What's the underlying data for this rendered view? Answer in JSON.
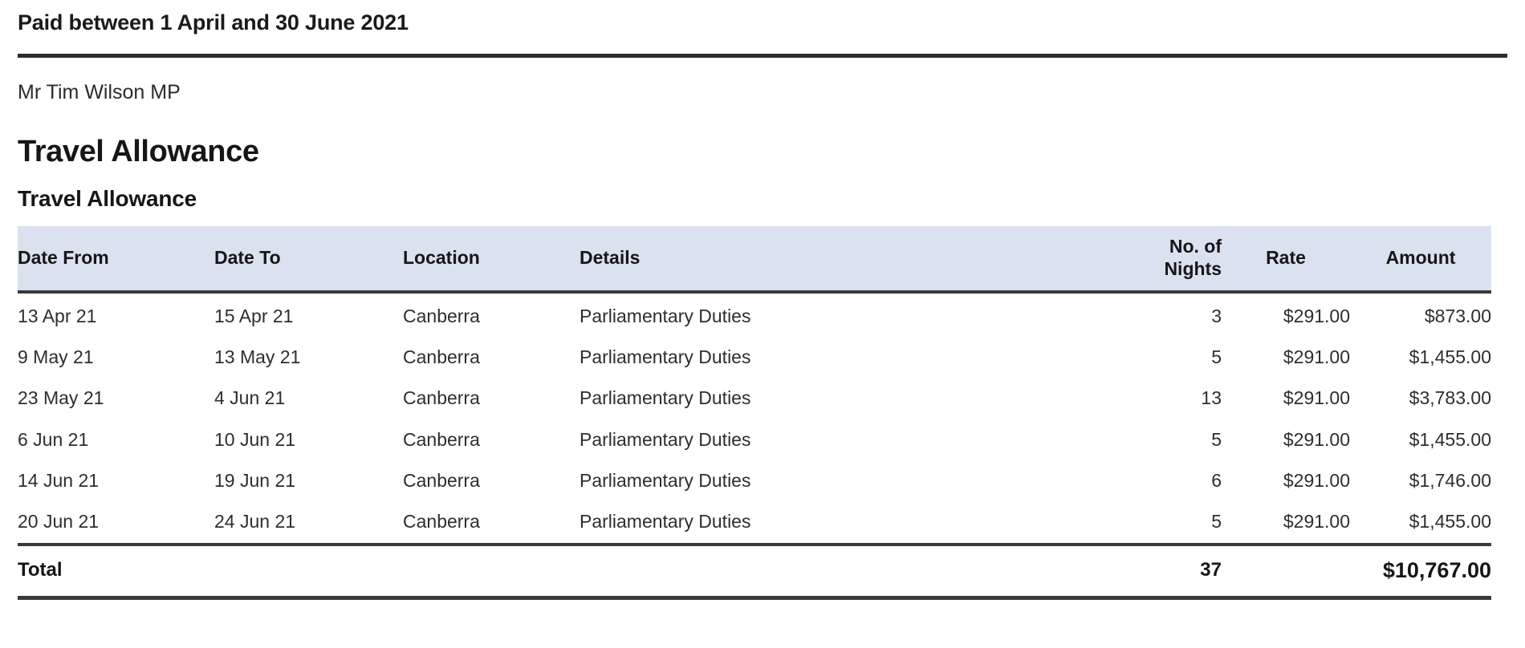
{
  "document": {
    "period_title": "Paid between 1 April and 30 June 2021",
    "member_name": "Mr Tim Wilson MP",
    "section_title": "Travel Allowance",
    "subsection_title": "Travel Allowance"
  },
  "colors": {
    "table_header_background": "#dae2ef",
    "rule": "#2b2b2b",
    "text": "#231f20"
  },
  "table": {
    "columns": [
      {
        "key": "date_from",
        "label": "Date From",
        "align": "left"
      },
      {
        "key": "date_to",
        "label": "Date To",
        "align": "left"
      },
      {
        "key": "location",
        "label": "Location",
        "align": "left"
      },
      {
        "key": "details",
        "label": "Details",
        "align": "left"
      },
      {
        "key": "nights",
        "label": "No. of Nights",
        "align": "right"
      },
      {
        "key": "rate",
        "label": "Rate",
        "align": "right"
      },
      {
        "key": "amount",
        "label": "Amount",
        "align": "right"
      }
    ],
    "header": {
      "date_from": "Date From",
      "date_to": "Date To",
      "location": "Location",
      "details": "Details",
      "nights_line1": "No. of",
      "nights_line2": "Nights",
      "rate": "Rate",
      "amount": "Amount"
    },
    "rows": [
      {
        "date_from": "13 Apr 21",
        "date_to": "15 Apr 21",
        "location": "Canberra",
        "details": "Parliamentary Duties",
        "nights": "3",
        "rate": "$291.00",
        "amount": "$873.00"
      },
      {
        "date_from": "9 May 21",
        "date_to": "13 May 21",
        "location": "Canberra",
        "details": "Parliamentary Duties",
        "nights": "5",
        "rate": "$291.00",
        "amount": "$1,455.00"
      },
      {
        "date_from": "23 May 21",
        "date_to": "4 Jun 21",
        "location": "Canberra",
        "details": "Parliamentary Duties",
        "nights": "13",
        "rate": "$291.00",
        "amount": "$3,783.00"
      },
      {
        "date_from": "6 Jun 21",
        "date_to": "10 Jun 21",
        "location": "Canberra",
        "details": "Parliamentary Duties",
        "nights": "5",
        "rate": "$291.00",
        "amount": "$1,455.00"
      },
      {
        "date_from": "14 Jun 21",
        "date_to": "19 Jun 21",
        "location": "Canberra",
        "details": "Parliamentary Duties",
        "nights": "6",
        "rate": "$291.00",
        "amount": "$1,746.00"
      },
      {
        "date_from": "20 Jun 21",
        "date_to": "24 Jun 21",
        "location": "Canberra",
        "details": "Parliamentary Duties",
        "nights": "5",
        "rate": "$291.00",
        "amount": "$1,455.00"
      }
    ],
    "total": {
      "label": "Total",
      "date_to": "",
      "location": "",
      "details": "",
      "nights": "37",
      "rate": "",
      "amount": "$10,767.00"
    }
  }
}
